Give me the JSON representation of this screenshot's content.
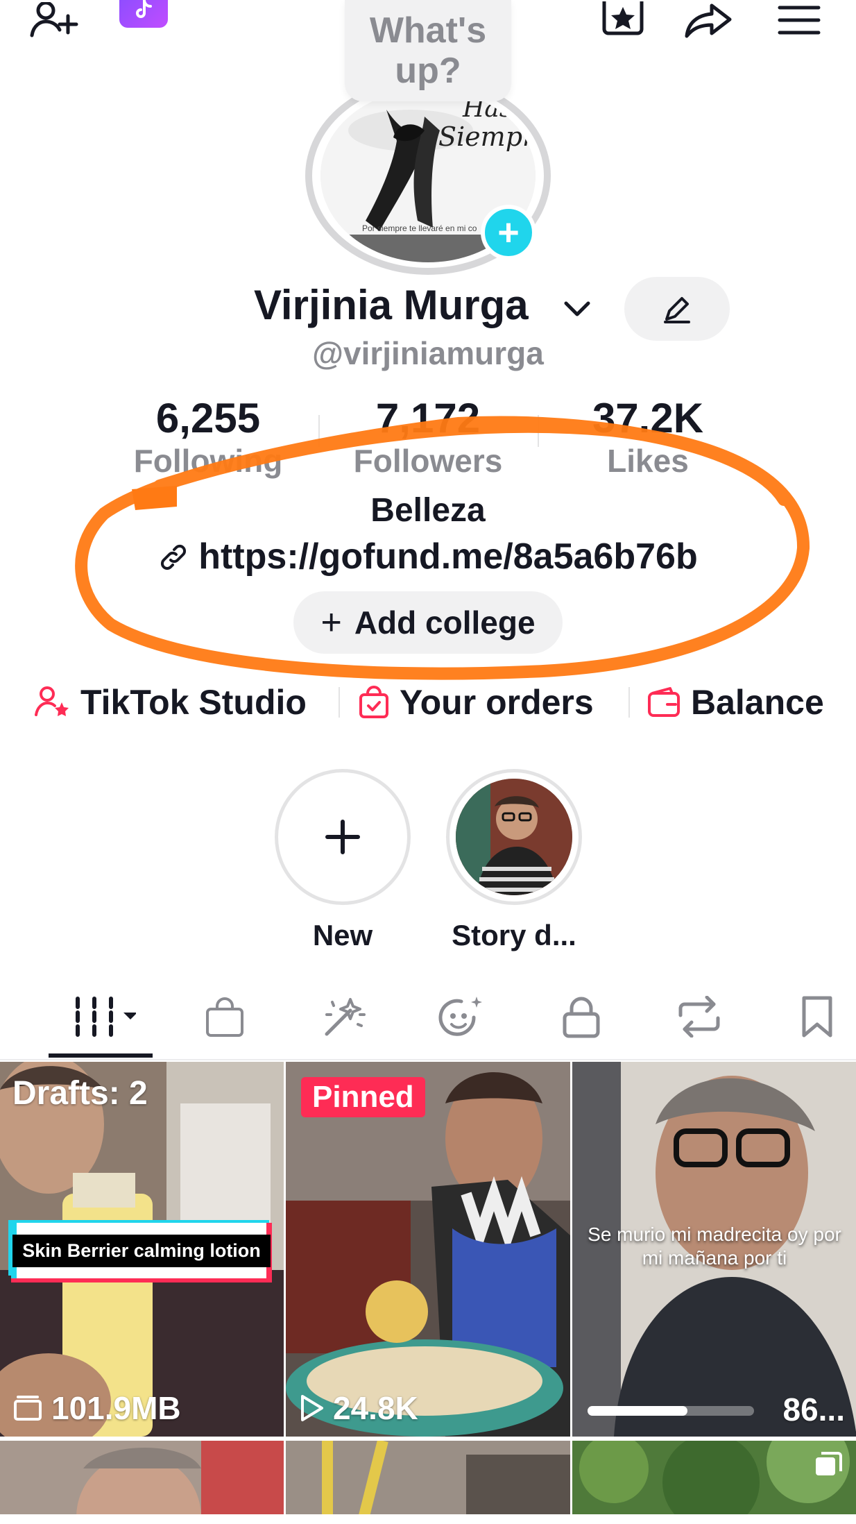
{
  "profile": {
    "bubble_text": "What's up?",
    "name": "Virjinia Murga",
    "handle": "@virjiniamurga",
    "avatar_text_1": "Hasta",
    "avatar_text_2": "Siempre!",
    "avatar_caption": "Por siempre te llevaré en mi co",
    "bio": "Belleza",
    "link": "https://gofund.me/8a5a6b76b",
    "add_college": "Add college"
  },
  "stats": [
    {
      "value": "6,255",
      "label": "Following"
    },
    {
      "value": "7,172",
      "label": "Followers"
    },
    {
      "value": "37.2K",
      "label": "Likes"
    }
  ],
  "shortcuts": [
    {
      "label": "TikTok Studio",
      "icon": "person-star-icon"
    },
    {
      "label": "Your orders",
      "icon": "shopping-bag-icon"
    },
    {
      "label": "Balance",
      "icon": "wallet-icon"
    }
  ],
  "stories": [
    {
      "label": "New"
    },
    {
      "label": "Story d..."
    }
  ],
  "tabs": [
    "videos-grid",
    "shop-bag",
    "magic-wand",
    "face-sparkle",
    "lock",
    "repost",
    "bookmark"
  ],
  "grid": [
    {
      "badge": "Drafts: 2",
      "caption": "Skin Berrier calming lotion",
      "stat": "101.9MB"
    },
    {
      "badge": "Pinned",
      "stat": "24.8K"
    },
    {
      "overlay": "Se murio mi madrecita oy por mi mañana por ti",
      "count": "86...",
      "progress": 0.6
    }
  ],
  "colors": {
    "accent_red": "#fe2c55",
    "accent_cyan": "#20d5ec",
    "highlight_orange": "#ff7a14",
    "text_gray": "#8a8b91"
  }
}
